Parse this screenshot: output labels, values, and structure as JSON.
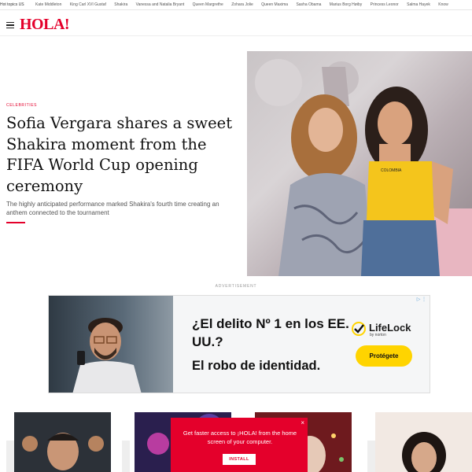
{
  "topics": {
    "label": "Hot topics US",
    "items": [
      "Kate Middleton",
      "King Carl XVI Gustaf",
      "Shakira",
      "Vanessa and Natalia Bryant",
      "Queen Margrethe",
      "Zohara Jolie",
      "Queen Maxima",
      "Sasha Obama",
      "Marius Borg Høiby",
      "Princess Leonor",
      "Salma Hayek",
      "Know"
    ]
  },
  "header": {
    "logo": "HOLA!",
    "menu_icon": "hamburger-menu-icon"
  },
  "hero": {
    "kicker": "CELEBRITIES",
    "headline": "Sofia Vergara shares a sweet Shakira moment from the FIFA World Cup opening ceremony",
    "dek": "The highly anticipated performance marked Shakira's fourth time creating an anthem connected to the tournament",
    "image_alt": "Shakira and Sofia Vergara posing together"
  },
  "ad": {
    "label": "ADVERTISEMENT",
    "headline": "¿El delito Nº 1 en los EE. UU.?",
    "subline": "El robo de identidad.",
    "brand": "LifeLock",
    "brand_by": "by norton",
    "cta": "Protégete",
    "info_icon": "ad-choices-icon"
  },
  "popup": {
    "message": "Get faster access to ¡HOLA! from the home screen of your computer.",
    "install_label": "INSTALL",
    "close_label": "×"
  },
  "colors": {
    "brand_red": "#e4002b",
    "cta_yellow": "#ffd400"
  }
}
